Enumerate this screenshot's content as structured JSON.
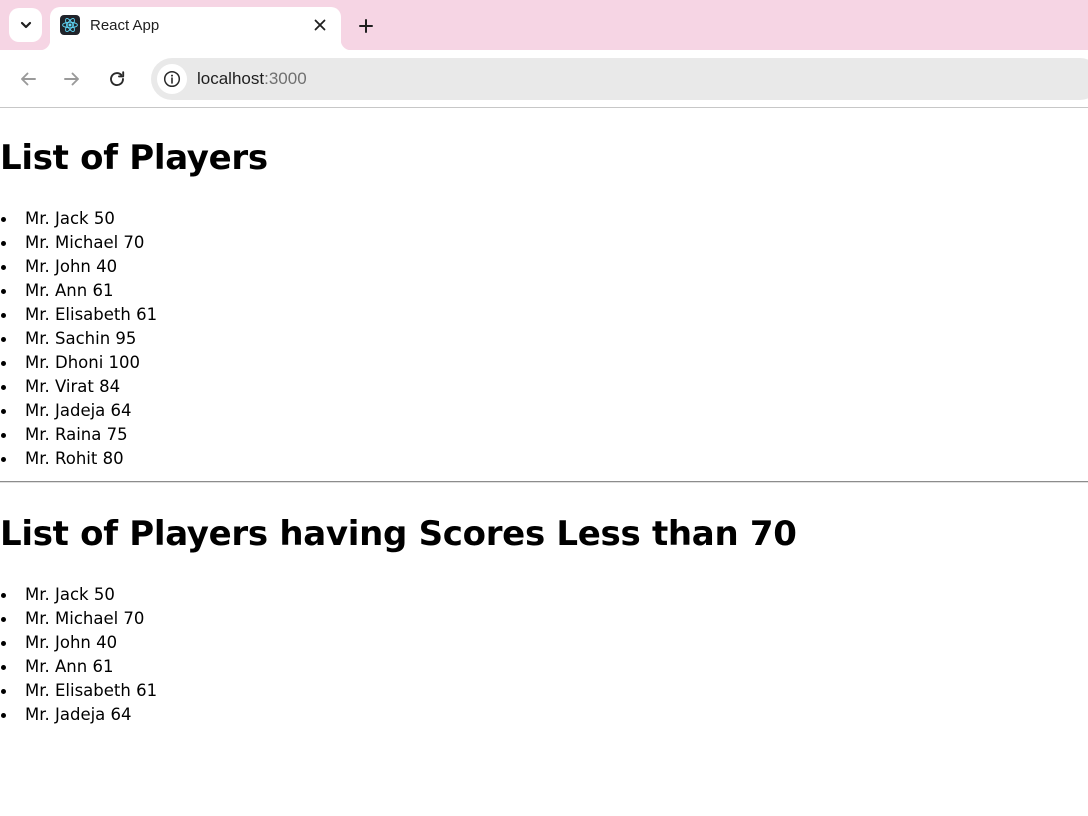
{
  "browser": {
    "tab_title": "React App",
    "url_host": "localhost",
    "url_port": ":3000",
    "icons": {
      "tab_search": "chevron-down-icon",
      "favicon": "react-logo-icon",
      "close": "close-icon",
      "new_tab": "plus-icon",
      "back": "arrow-left-icon",
      "forward": "arrow-right-icon",
      "reload": "reload-icon",
      "site_info": "info-icon"
    },
    "colors": {
      "tab_strip": "#f6d5e4",
      "omnibox": "#e9e9e9"
    }
  },
  "section_all": {
    "heading": "List of Players",
    "players": [
      {
        "text": "Mr. Jack 50"
      },
      {
        "text": "Mr. Michael 70"
      },
      {
        "text": "Mr. John 40"
      },
      {
        "text": "Mr. Ann 61"
      },
      {
        "text": "Mr. Elisabeth 61"
      },
      {
        "text": "Mr. Sachin 95"
      },
      {
        "text": "Mr. Dhoni 100"
      },
      {
        "text": "Mr. Virat 84"
      },
      {
        "text": "Mr. Jadeja 64"
      },
      {
        "text": "Mr. Raina 75"
      },
      {
        "text": "Mr. Rohit 80"
      }
    ]
  },
  "section_low": {
    "heading": "List of Players having Scores Less than 70",
    "players": [
      {
        "text": "Mr. Jack 50"
      },
      {
        "text": "Mr. Michael 70"
      },
      {
        "text": "Mr. John 40"
      },
      {
        "text": "Mr. Ann 61"
      },
      {
        "text": "Mr. Elisabeth 61"
      },
      {
        "text": "Mr. Jadeja 64"
      }
    ]
  }
}
